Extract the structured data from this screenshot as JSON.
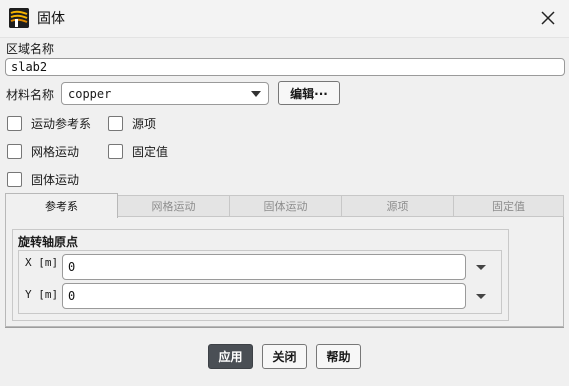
{
  "window": {
    "title": "固体"
  },
  "zone": {
    "label": "区域名称",
    "value": "slab2"
  },
  "material": {
    "label": "材料名称",
    "value": "copper",
    "edit_label": "编辑···"
  },
  "options": [
    {
      "label": "运动参考系",
      "checked": false
    },
    {
      "label": "源项",
      "checked": false
    },
    {
      "label": "网格运动",
      "checked": false
    },
    {
      "label": "固定值",
      "checked": false
    },
    {
      "label": "固体运动",
      "checked": false
    }
  ],
  "tabs": [
    {
      "label": "参考系",
      "active": true
    },
    {
      "label": "网格运动",
      "active": false
    },
    {
      "label": "固体运动",
      "active": false
    },
    {
      "label": "源项",
      "active": false
    },
    {
      "label": "固定值",
      "active": false
    }
  ],
  "origin": {
    "title": "旋转轴原点",
    "x_label": "X [m]",
    "x_value": "0",
    "y_label": "Y [m]",
    "y_value": "0"
  },
  "footer": {
    "apply": "应用",
    "close": "关闭",
    "help": "帮助"
  },
  "colors": {
    "primary_button": "#4a4f55",
    "active_tab_text": "#111111",
    "inactive_tab_text": "#8d8d8d"
  },
  "icons": {
    "app": "fluent-app-icon",
    "close": "close-icon",
    "dropdown": "chevron-down-icon"
  }
}
